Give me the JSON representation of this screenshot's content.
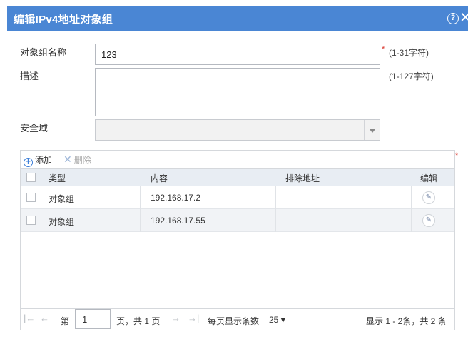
{
  "dialog": {
    "title": "编辑IPv4地址对象组",
    "help_symbol": "?",
    "close_symbol": "✕"
  },
  "form": {
    "name_label": "对象组名称",
    "name_value": "123",
    "name_required": "*",
    "name_hint": "(1-31字符)",
    "desc_label": "描述",
    "desc_value": "",
    "desc_hint": "(1-127字符)",
    "zone_label": "安全域",
    "zone_value": ""
  },
  "grid": {
    "required_mark": "*",
    "toolbar": {
      "add_label": "添加",
      "add_icon": "plus-circle-icon",
      "delete_label": "删除",
      "delete_icon": "cross-icon"
    },
    "columns": [
      "类型",
      "内容",
      "排除地址",
      "编辑"
    ],
    "rows": [
      {
        "type": "对象组",
        "content": "192.168.17.2",
        "exclude": ""
      },
      {
        "type": "对象组",
        "content": "192.168.17.55",
        "exclude": ""
      }
    ],
    "pager": {
      "first": "|←",
      "prev": "←",
      "page_prefix": "第",
      "page_value": "1",
      "page_suffix": "页，共 1 页",
      "next": "→",
      "last": "→|",
      "per_page_label": "每页显示条数",
      "per_page_value": "25",
      "per_page_arrow": "▾",
      "summary": "显示 1 - 2条，共 2 条"
    }
  },
  "colors": {
    "titlebar": "#4a86d4",
    "required": "#d9352b",
    "header_bg": "#e8edf3",
    "alt_row": "#f1f3f6"
  }
}
